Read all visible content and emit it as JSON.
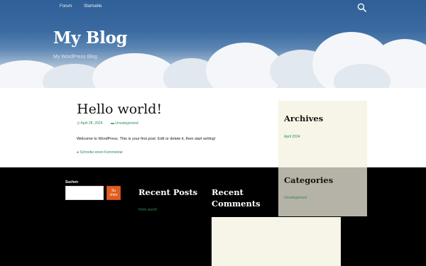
{
  "nav": {
    "items": [
      "Forum",
      "Startseite"
    ]
  },
  "site": {
    "title": "My Blog",
    "tagline": "My WordPress Blog"
  },
  "post": {
    "title": "Hello world!",
    "date": "April 28, 2024",
    "category": "Uncategorized",
    "content": "Welcome to WordPress. This is your first post. Edit or delete it, then start writing!",
    "comment_link": "Schreibe einen Kommentar"
  },
  "sidebar": {
    "archives": {
      "title": "Archives",
      "items": [
        "April 2024"
      ]
    },
    "categories": {
      "title": "Categories",
      "items": [
        "Uncategorized"
      ]
    }
  },
  "footer": {
    "search": {
      "label": "Suchen",
      "button": "Suchen",
      "value": ""
    },
    "recent_posts": {
      "title": "Recent Posts",
      "items": [
        "Hello world!"
      ]
    },
    "recent_comments": {
      "title": "Recent Comments"
    }
  },
  "colors": {
    "header_blue": "#3a6aa0",
    "link_green": "#2b8a55",
    "search_orange": "#e05d22",
    "widget_cream": "#f7f5e7",
    "widget_gray": "#b5b3a7"
  },
  "icons": {
    "search": "search-icon",
    "clock": "clock-icon",
    "folder": "folder-icon",
    "comment": "comment-icon"
  }
}
